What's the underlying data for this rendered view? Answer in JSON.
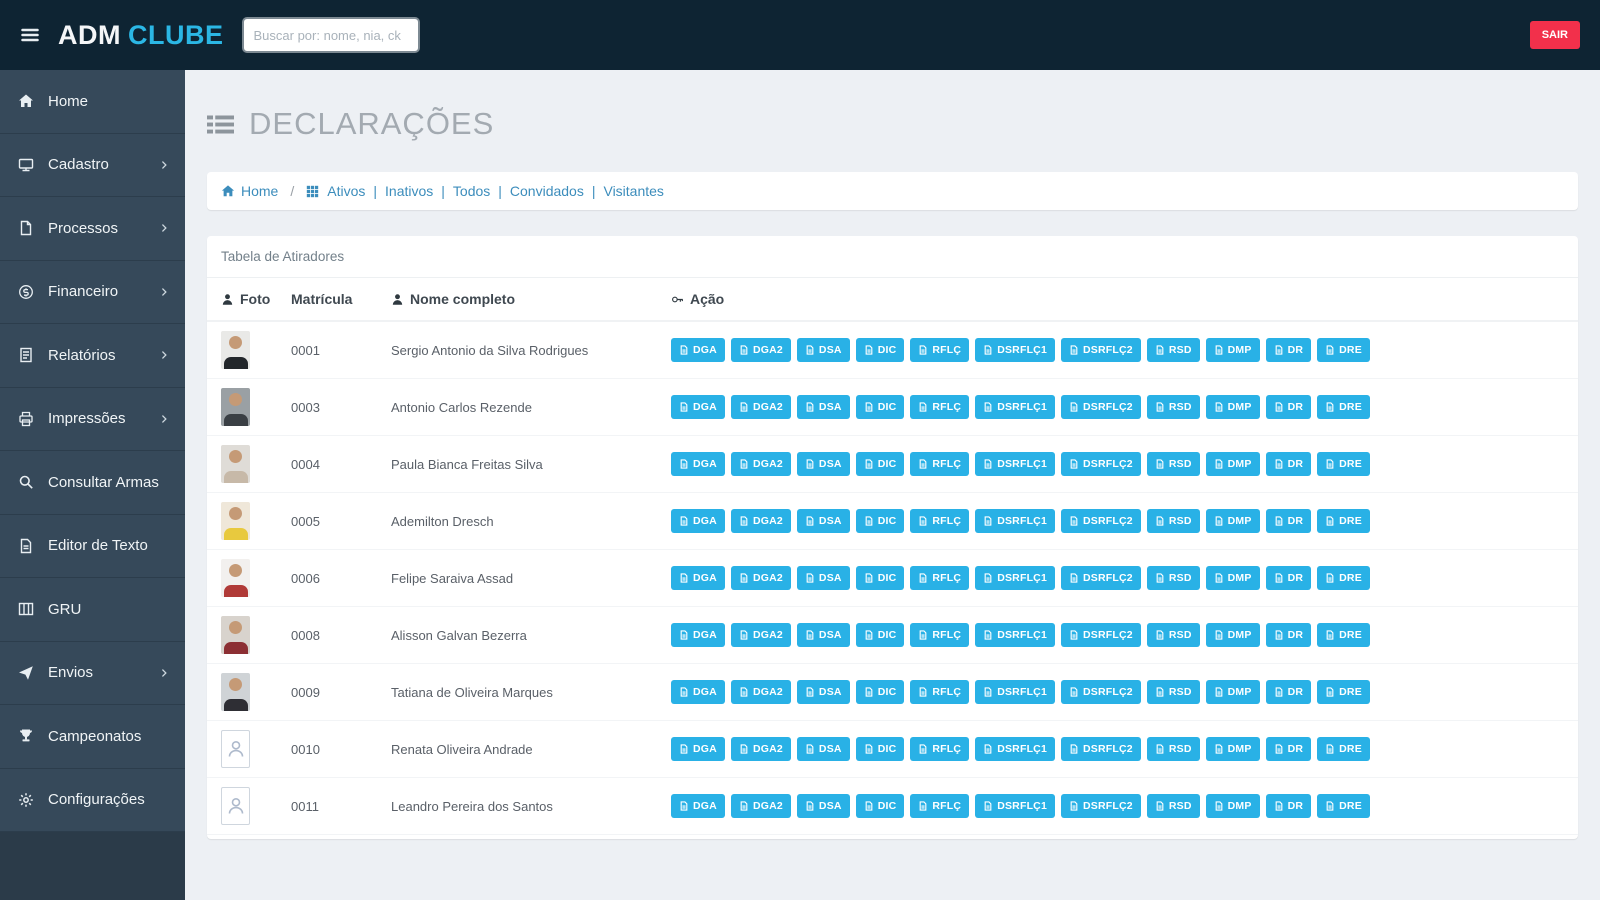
{
  "colors": {
    "topbar_bg": "#0e2433",
    "sidebar_bg": "#36495a",
    "accent_blue": "#29b1e6",
    "link_blue": "#3c8dbc",
    "logout_red": "#f2304b",
    "brand_cyan": "#2bb7e5"
  },
  "topbar": {
    "brand_adm": "ADM",
    "brand_clube": "CLUBE",
    "search_placeholder": "Buscar por: nome, nia, ck",
    "logout_label": "SAIR"
  },
  "sidebar": {
    "items": [
      {
        "id": "home",
        "label": "Home",
        "icon": "home-icon",
        "arrow": false
      },
      {
        "id": "cadastro",
        "label": "Cadastro",
        "icon": "monitor-icon",
        "arrow": true
      },
      {
        "id": "processos",
        "label": "Processos",
        "icon": "file-icon",
        "arrow": true
      },
      {
        "id": "financeiro",
        "label": "Financeiro",
        "icon": "money-icon",
        "arrow": true
      },
      {
        "id": "relatorios",
        "label": "Relatórios",
        "icon": "report-icon",
        "arrow": true
      },
      {
        "id": "impressoes",
        "label": "Impressões",
        "icon": "printer-icon",
        "arrow": true
      },
      {
        "id": "consultar-armas",
        "label": "Consultar Armas",
        "icon": "search-icon",
        "arrow": false
      },
      {
        "id": "editor-de-texto",
        "label": "Editor de Texto",
        "icon": "document-icon",
        "arrow": false
      },
      {
        "id": "gru",
        "label": "GRU",
        "icon": "table-icon",
        "arrow": false
      },
      {
        "id": "envios",
        "label": "Envios",
        "icon": "send-icon",
        "arrow": true
      },
      {
        "id": "campeonatos",
        "label": "Campeonatos",
        "icon": "trophy-icon",
        "arrow": false
      },
      {
        "id": "configuracoes",
        "label": "Configurações",
        "icon": "gear-icon",
        "arrow": false
      }
    ]
  },
  "page": {
    "title": "DECLARAÇÕES",
    "breadcrumb_home": "Home",
    "filters": [
      "Ativos",
      "Inativos",
      "Todos",
      "Convidados",
      "Visitantes"
    ]
  },
  "table": {
    "card_title": "Tabela de Atiradores",
    "headers": [
      {
        "label": "Foto",
        "icon": "person-icon"
      },
      {
        "label": "Matrícula",
        "icon": null
      },
      {
        "label": "Nome completo",
        "icon": "person-icon"
      },
      {
        "label": "Ação",
        "icon": "key-icon"
      }
    ],
    "action_buttons": [
      "DGA",
      "DGA2",
      "DSA",
      "DIC",
      "RFLÇ",
      "DSRFLÇ1",
      "DSRFLÇ2",
      "RSD",
      "DMP",
      "DR",
      "DRE"
    ],
    "rows": [
      {
        "matricula": "0001",
        "nome": "Sergio Antonio da Silva Rodrigues",
        "avatar": {
          "type": "photo",
          "bg": "#e9e9e7",
          "shirt": "#23272b"
        }
      },
      {
        "matricula": "0003",
        "nome": "Antonio Carlos Rezende",
        "avatar": {
          "type": "photo",
          "bg": "#9aa0a4",
          "shirt": "#3a3f44"
        }
      },
      {
        "matricula": "0004",
        "nome": "Paula Bianca Freitas Silva",
        "avatar": {
          "type": "photo",
          "bg": "#dfdcd7",
          "shirt": "#c7b9a8"
        }
      },
      {
        "matricula": "0005",
        "nome": "Ademilton Dresch",
        "avatar": {
          "type": "photo",
          "bg": "#efe7d9",
          "shirt": "#e8c93e"
        }
      },
      {
        "matricula": "0006",
        "nome": "Felipe Saraiva Assad",
        "avatar": {
          "type": "photo",
          "bg": "#f2f0ee",
          "shirt": "#b03a37"
        }
      },
      {
        "matricula": "0008",
        "nome": "Alisson Galvan Bezerra",
        "avatar": {
          "type": "photo",
          "bg": "#d8d3cd",
          "shirt": "#8c2f33"
        }
      },
      {
        "matricula": "0009",
        "nome": "Tatiana de Oliveira Marques",
        "avatar": {
          "type": "photo",
          "bg": "#cfd3d6",
          "shirt": "#2e2e34"
        }
      },
      {
        "matricula": "0010",
        "nome": "Renata Oliveira Andrade",
        "avatar": {
          "type": "placeholder"
        }
      },
      {
        "matricula": "0011",
        "nome": "Leandro Pereira dos Santos",
        "avatar": {
          "type": "placeholder"
        }
      }
    ]
  }
}
